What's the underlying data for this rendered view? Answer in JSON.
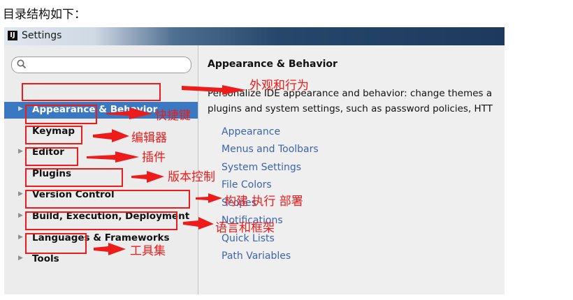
{
  "caption": "目录结构如下：",
  "window": {
    "title": "Settings",
    "app_icon": "intellij-icon"
  },
  "search": {
    "placeholder": ""
  },
  "tree": [
    {
      "label": "Appearance & Behavior",
      "expandable": true,
      "selected": true
    },
    {
      "label": "Keymap",
      "expandable": false,
      "selected": false
    },
    {
      "label": "Editor",
      "expandable": true,
      "selected": false
    },
    {
      "label": "Plugins",
      "expandable": false,
      "selected": false
    },
    {
      "label": "Version Control",
      "expandable": true,
      "selected": false
    },
    {
      "label": "Build, Execution, Deployment",
      "expandable": true,
      "selected": false
    },
    {
      "label": "Languages & Frameworks",
      "expandable": true,
      "selected": false
    },
    {
      "label": "Tools",
      "expandable": true,
      "selected": false
    }
  ],
  "content": {
    "title": "Appearance & Behavior",
    "description_line1": "Personalize IDE appearance and behavior: change themes a",
    "description_line2": "plugins and system settings, such as password policies, HTT",
    "links": [
      "Appearance",
      "Menus and Toolbars",
      "System Settings",
      "File Colors",
      "Scopes",
      "Notifications",
      "Quick Lists",
      "Path Variables"
    ]
  },
  "annotations": [
    {
      "target": "Appearance & Behavior",
      "text": "外观和行为"
    },
    {
      "target": "Keymap",
      "text": "快捷键"
    },
    {
      "target": "Editor",
      "text": "编辑器"
    },
    {
      "target": "Plugins",
      "text": "插件"
    },
    {
      "target": "Version Control",
      "text": "版本控制"
    },
    {
      "target": "Build, Execution, Deployment",
      "text": "构建 执行 部署"
    },
    {
      "target": "Languages & Frameworks",
      "text": "语言和框架"
    },
    {
      "target": "Tools",
      "text": "工具集"
    }
  ],
  "colors": {
    "annotation": "#ee1b1b",
    "selection": "#3a79c2",
    "link": "#3d64a8"
  }
}
